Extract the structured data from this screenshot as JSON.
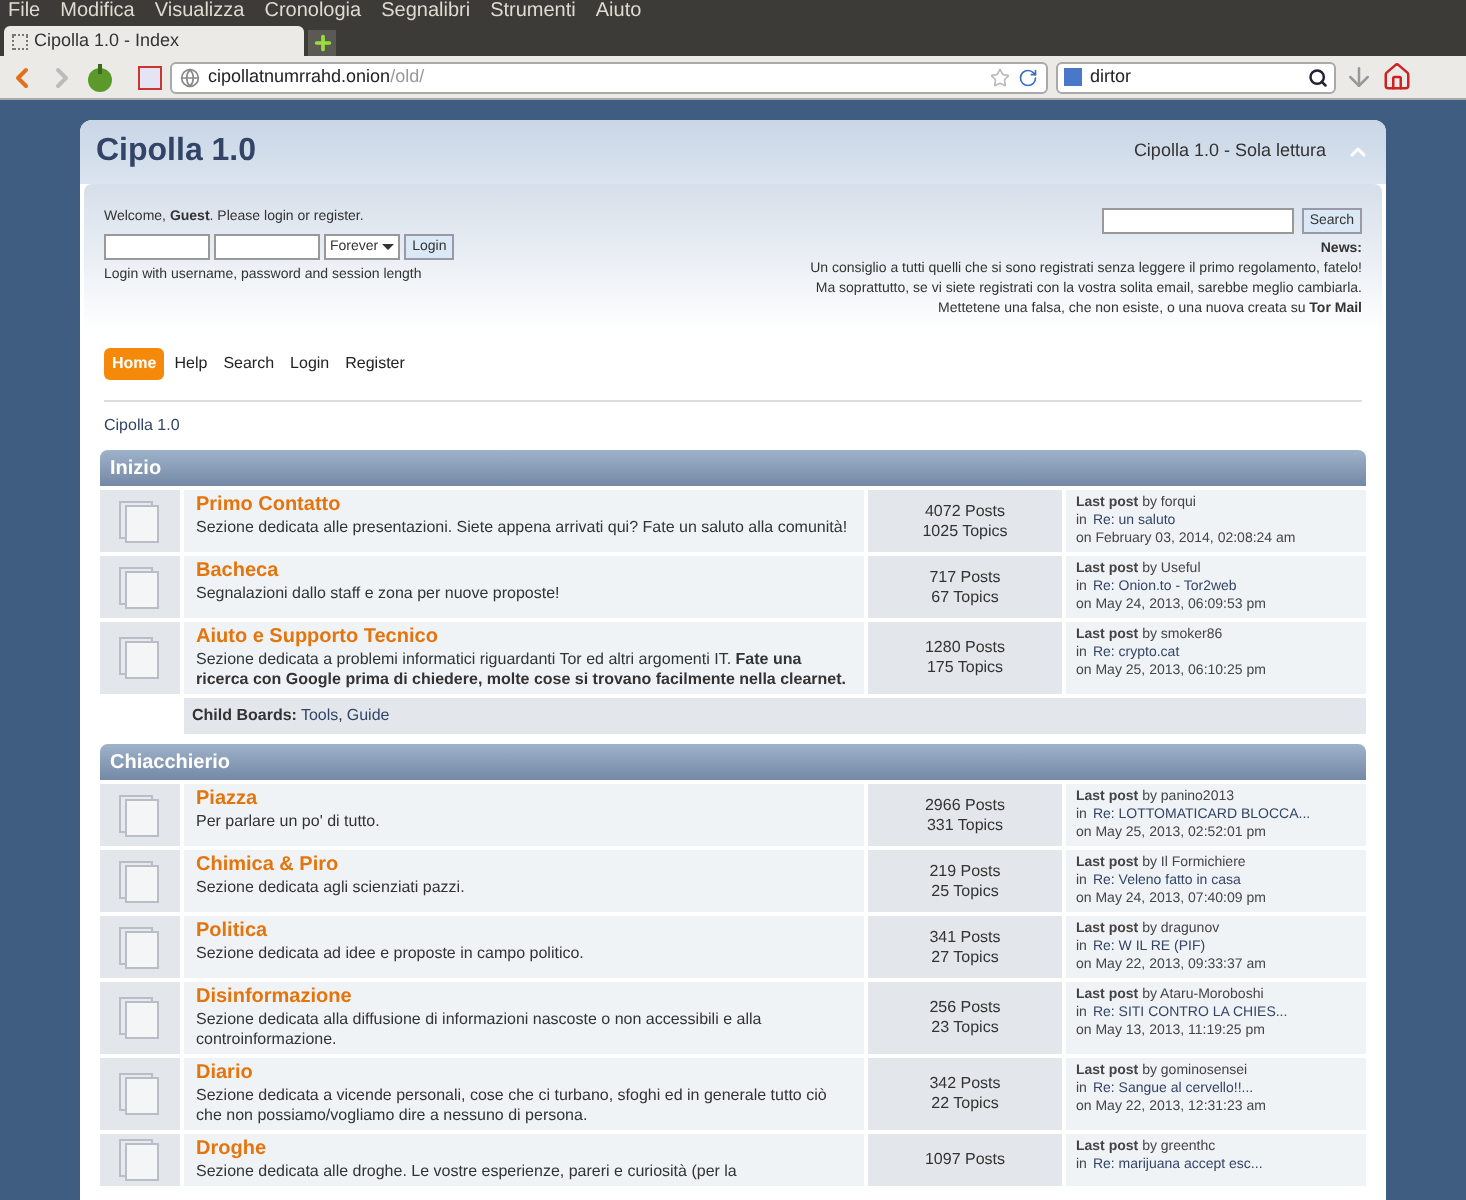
{
  "browser": {
    "menu": [
      "File",
      "Modifica",
      "Visualizza",
      "Cronologia",
      "Segnalibri",
      "Strumenti",
      "Aiuto"
    ],
    "tab_title": "Cipolla 1.0 - Index",
    "url_host": "cipollatnumrrahd.onion",
    "url_path": "/old/",
    "search_value": "dirtor"
  },
  "forum": {
    "title": "Cipolla 1.0",
    "subtitle": "Cipolla 1.0 - Sola lettura",
    "welcome": "Welcome, **Guest**. Please login or register.",
    "session": "Forever",
    "login_button": "Login",
    "login_hint": "Login with username, password and session length",
    "search_button": "Search",
    "news_label": "News:",
    "news": [
      "Un consiglio a tutti quelli che si sono registrati senza leggere il primo regolamento, fatelo!",
      "Ma soprattutto, se vi siete registrati con la vostra solita email, sarebbe meglio cambiarla.",
      "Mettetene una falsa, che non esiste, o una nuova creata su **Tor Mail**"
    ],
    "nav": [
      {
        "label": "Home",
        "selected": true
      },
      {
        "label": "Help",
        "selected": false
      },
      {
        "label": "Search",
        "selected": false
      },
      {
        "label": "Login",
        "selected": false
      },
      {
        "label": "Register",
        "selected": false
      }
    ],
    "breadcrumb": "Cipolla 1.0",
    "categories": [
      {
        "name": "Inizio",
        "boards": [
          {
            "name": "Primo Contatto",
            "description": "Sezione dedicata alle presentazioni. Siete appena arrivati qui? Fate un saluto alla comunità!",
            "posts": "4072 Posts",
            "topics": "1025 Topics",
            "last_post": "**Last post** by forqui",
            "in": "in",
            "topic": "Re: un saluto",
            "date": "on February 03, 2014, 02:08:24 am"
          },
          {
            "name": "Bacheca",
            "description": "Segnalazioni dallo staff e zona per nuove proposte!",
            "posts": "717 Posts",
            "topics": "67 Topics",
            "last_post": "**Last post** by Useful",
            "in": "in",
            "topic": "Re: Onion.to - Tor2web",
            "date": "on May 24, 2013, 06:09:53 pm"
          },
          {
            "name": "Aiuto e Supporto Tecnico",
            "description": "Sezione dedicata a problemi informatici riguardanti Tor ed altri argomenti IT. **Fate una ricerca con Google prima di chiedere, molte cose si trovano facilmente nella clearnet.**",
            "posts": "1280 Posts",
            "topics": "175 Topics",
            "last_post": "**Last post** by smoker86",
            "in": "in",
            "topic": "Re: crypto.cat",
            "date": "on May 25, 2013, 06:10:25 pm"
          }
        ],
        "child_boards": {
          "label": "Child Boards:",
          "separator": ",",
          "links": [
            "Tools",
            "Guide"
          ]
        }
      },
      {
        "name": "Chiacchierio",
        "boards": [
          {
            "name": "Piazza",
            "description": "Per parlare un po' di tutto.",
            "posts": "2966 Posts",
            "topics": "331 Topics",
            "last_post": "**Last post** by panino2013",
            "in": "in",
            "topic": "Re: LOTTOMATICARD BLOCCA...",
            "date": "on May 25, 2013, 02:52:01 pm"
          },
          {
            "name": "Chimica & Piro",
            "description": "Sezione dedicata agli scienziati pazzi.",
            "posts": "219 Posts",
            "topics": "25 Topics",
            "last_post": "**Last post** by Il Formichiere",
            "in": "in",
            "topic": "Re: Veleno fatto in casa",
            "date": "on May 24, 2013, 07:40:09 pm"
          },
          {
            "name": "Politica",
            "description": "Sezione dedicata ad idee e proposte in campo politico.",
            "posts": "341 Posts",
            "topics": "27 Topics",
            "last_post": "**Last post** by dragunov",
            "in": "in",
            "topic": "Re: W IL RE (PIF)",
            "date": "on May 22, 2013, 09:33:37 am"
          },
          {
            "name": "Disinformazione",
            "description": "Sezione dedicata alla diffusione di informazioni nascoste o non accessibili e alla controinformazione.",
            "posts": "256 Posts",
            "topics": "23 Topics",
            "last_post": "**Last post** by Ataru-Moroboshi",
            "in": "in",
            "topic": "Re: SITI CONTRO LA CHIES...",
            "date": "on May 13, 2013, 11:19:25 pm"
          },
          {
            "name": "Diario",
            "description": "Sezione dedicata a vicende personali, cose che ci turbano, sfoghi ed in generale tutto ciò che non possiamo/vogliamo dire a nessuno di persona.",
            "posts": "342 Posts",
            "topics": "22 Topics",
            "last_post": "**Last post** by gominosensei",
            "in": "in",
            "topic": "Re: Sangue al cervello!!...",
            "date": "on May 22, 2013, 12:31:23 am"
          },
          {
            "name": "Droghe",
            "description": "Sezione dedicata alle droghe. Le vostre esperienze, pareri e curiosità (per la",
            "posts": "1097 Posts",
            "last_post": "**Last post** by greenthc",
            "in": "in",
            "topic": "Re: marijuana accept esc..."
          }
        ]
      }
    ]
  }
}
